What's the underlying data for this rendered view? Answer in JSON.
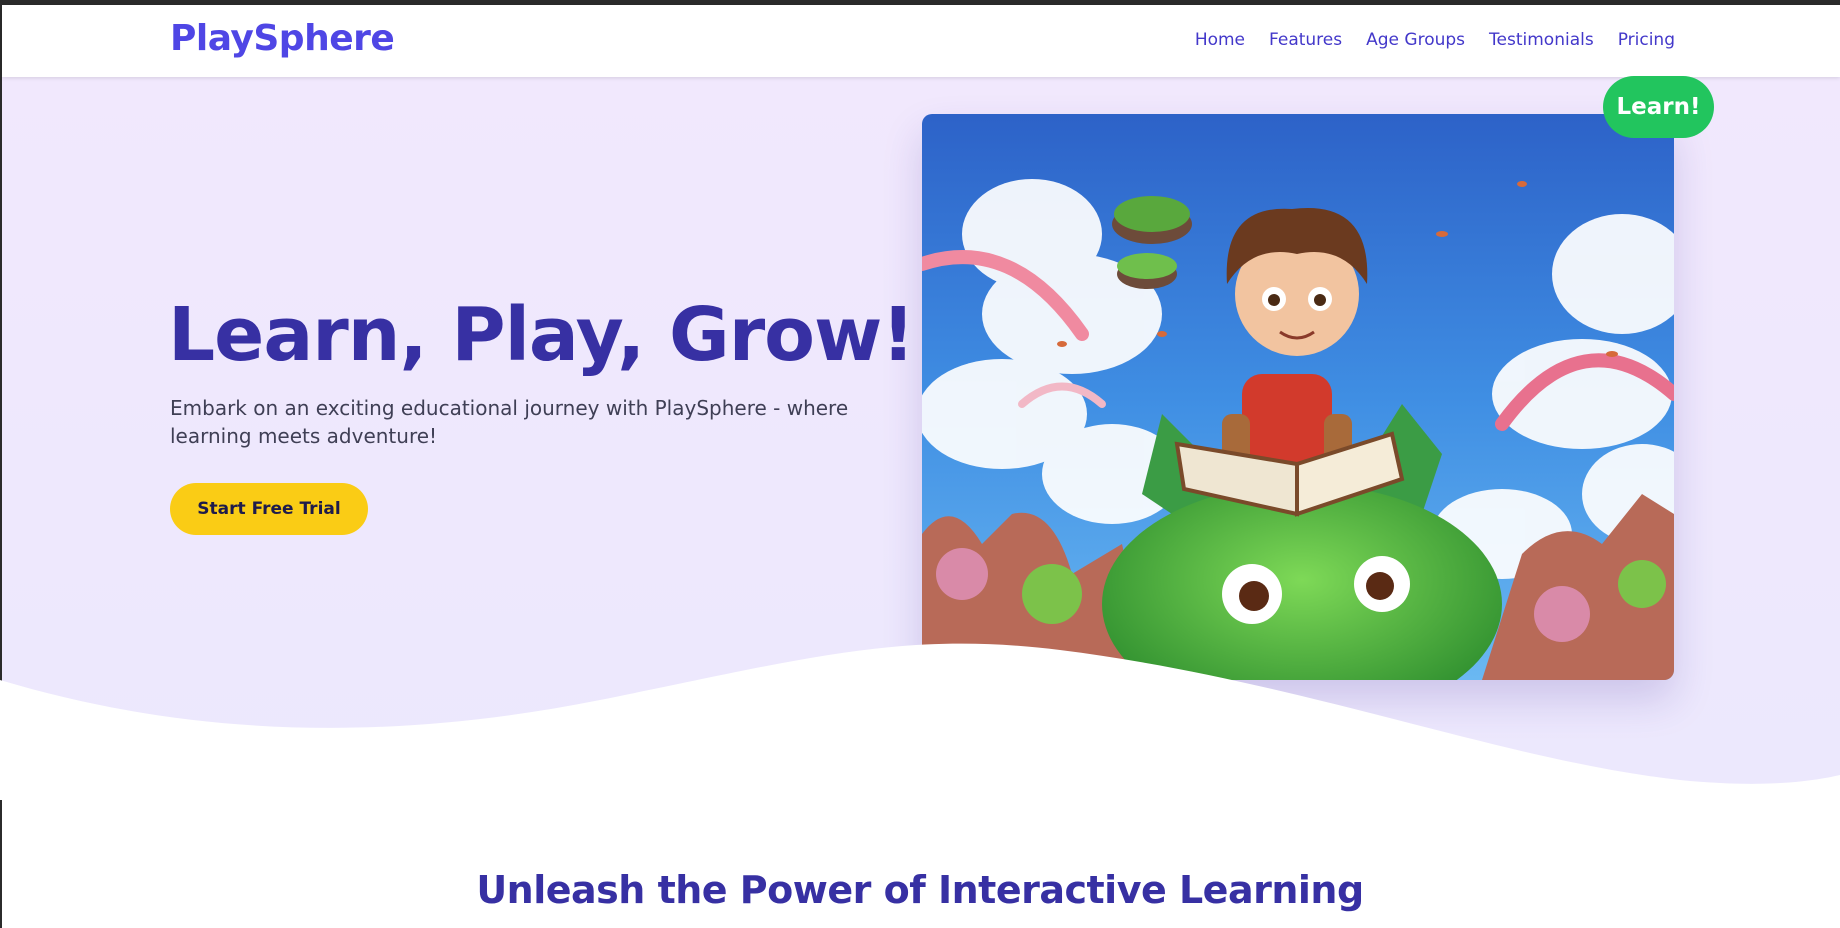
{
  "brand": {
    "name": "PlaySphere",
    "color": "#4f46e5"
  },
  "nav": {
    "items": [
      {
        "label": "Home"
      },
      {
        "label": "Features"
      },
      {
        "label": "Age Groups"
      },
      {
        "label": "Testimonials"
      },
      {
        "label": "Pricing"
      }
    ]
  },
  "hero": {
    "headline": "Learn, Play, Grow!",
    "subtext": "Embark on an exciting educational journey with PlaySphere - where learning meets adventure!",
    "cta_label": "Start Free Trial",
    "badge_label": "Learn!",
    "image_icon": "illustration-child-reading-on-dragon"
  },
  "features_section": {
    "title": "Unleash the Power of Interactive Learning"
  },
  "colors": {
    "primary": "#3730a3",
    "accent_yellow": "#facc15",
    "accent_green": "#22c55e",
    "hero_bg": "#f1e8fd"
  }
}
